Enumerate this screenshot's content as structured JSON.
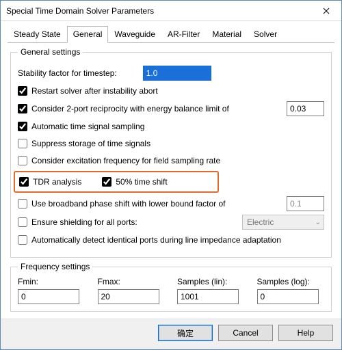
{
  "window": {
    "title": "Special Time Domain Solver Parameters"
  },
  "tabs": [
    "Steady State",
    "General",
    "Waveguide",
    "AR-Filter",
    "Material",
    "Solver"
  ],
  "active_tab": 1,
  "general_settings": {
    "legend": "General settings",
    "stability_label": "Stability factor for timestep:",
    "stability_value": "1.0",
    "restart": {
      "checked": true,
      "label": "Restart solver after instability abort"
    },
    "reciprocity": {
      "checked": true,
      "label": "Consider 2-port reciprocity with energy balance limit of",
      "value": "0.03"
    },
    "sampling": {
      "checked": true,
      "label": "Automatic time signal sampling"
    },
    "suppress": {
      "checked": false,
      "label": "Suppress storage of time signals"
    },
    "excitation": {
      "checked": false,
      "label": "Consider excitation frequency for field sampling rate"
    },
    "tdr": {
      "checked": true,
      "label": "TDR analysis"
    },
    "timeshift": {
      "checked": true,
      "label": "50% time shift"
    },
    "broadband": {
      "checked": false,
      "label": "Use broadband phase shift with lower bound factor of",
      "value": "0.1"
    },
    "shielding": {
      "checked": false,
      "label": "Ensure shielding for all ports:",
      "select": "Electric"
    },
    "auto_detect": {
      "checked": false,
      "label": "Automatically detect identical ports during line impedance adaptation"
    }
  },
  "frequency_settings": {
    "legend": "Frequency settings",
    "fmin": {
      "label": "Fmin:",
      "value": "0"
    },
    "fmax": {
      "label": "Fmax:",
      "value": "20"
    },
    "samples_lin": {
      "label": "Samples (lin):",
      "value": "1001"
    },
    "samples_log": {
      "label": "Samples (log):",
      "value": "0"
    }
  },
  "buttons": {
    "ok": "确定",
    "cancel": "Cancel",
    "help": "Help"
  }
}
